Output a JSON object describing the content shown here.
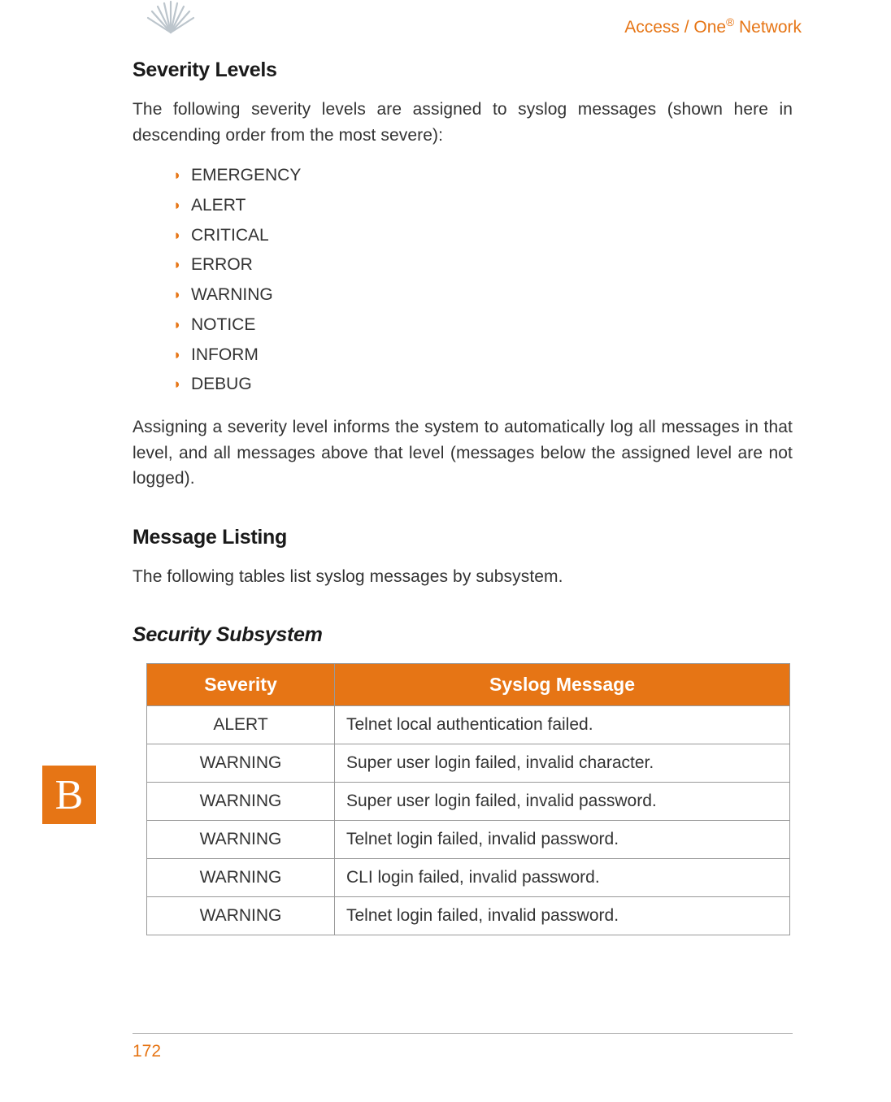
{
  "header": {
    "brand_prefix": "Access / One",
    "brand_suffix": " Network",
    "reg": "®"
  },
  "sections": {
    "severity": {
      "title": "Severity Levels",
      "intro": "The following severity levels are assigned to syslog messages (shown here in descending order from the most severe):",
      "levels": [
        "EMERGENCY",
        "ALERT",
        "CRITICAL",
        "ERROR",
        "WARNING",
        "NOTICE",
        "INFORM",
        "DEBUG"
      ],
      "footer": "Assigning a severity level informs the system to automatically log all messages in that level, and all messages above that level (messages below the assigned level are not logged)."
    },
    "listing": {
      "title": "Message Listing",
      "intro": "The following tables list syslog messages by subsystem."
    },
    "security": {
      "title": "Security Subsystem",
      "columns": [
        "Severity",
        "Syslog Message"
      ],
      "rows": [
        {
          "severity": "ALERT",
          "message": "Telnet local authentication failed."
        },
        {
          "severity": "WARNING",
          "message": "Super user login failed, invalid character."
        },
        {
          "severity": "WARNING",
          "message": "Super user login failed, invalid password."
        },
        {
          "severity": "WARNING",
          "message": "Telnet login failed, invalid password."
        },
        {
          "severity": "WARNING",
          "message": "CLI login failed, invalid password."
        },
        {
          "severity": "WARNING",
          "message": "Telnet login failed, invalid password."
        }
      ]
    }
  },
  "sidebar": {
    "letter": "B"
  },
  "page_number": "172"
}
